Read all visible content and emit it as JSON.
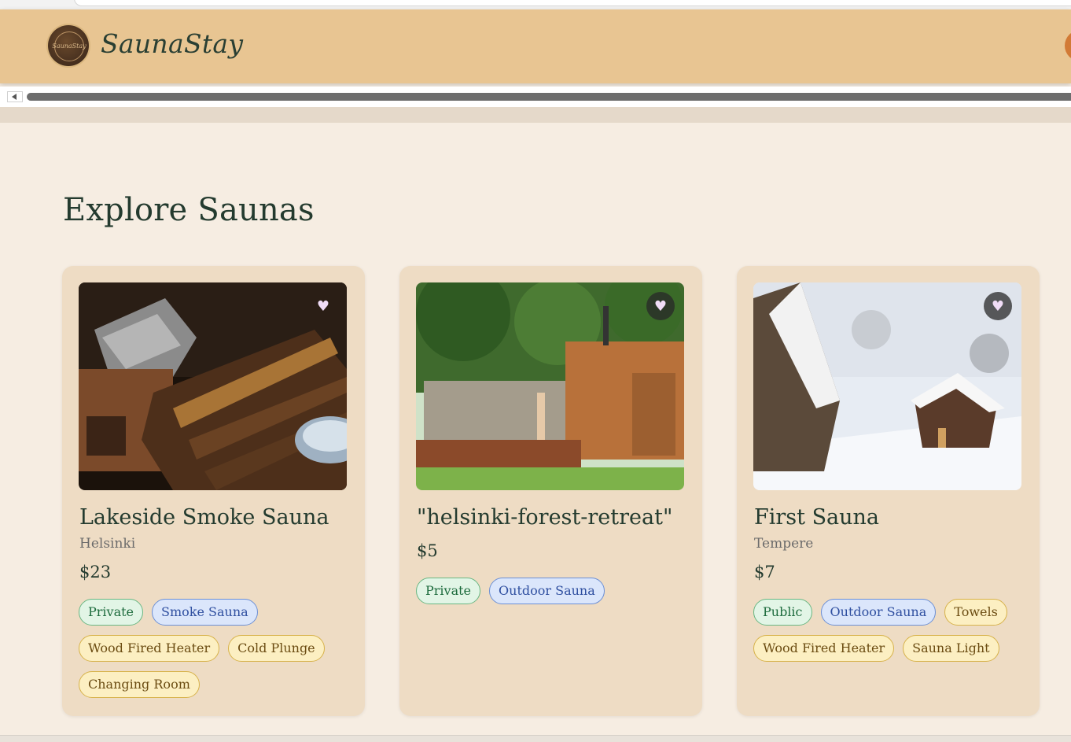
{
  "app": {
    "name": "SaunaStay",
    "logo_text": "SaunaStay"
  },
  "page": {
    "title": "Explore Saunas"
  },
  "colors": {
    "header_bg": "#e8c592",
    "page_bg": "#f6ede2",
    "card_bg": "#eedcc4",
    "tag_type": "#e2f5e6",
    "tag_sauna_type": "#dbe6fb",
    "tag_amenity": "#fcefc2"
  },
  "saunas": [
    {
      "title": "Lakeside Smoke Sauna",
      "location": "Helsinki",
      "price": "$23",
      "image": "sauna-interior-photo",
      "tags": [
        {
          "label": "Private",
          "kind": "green"
        },
        {
          "label": "Smoke Sauna",
          "kind": "blue"
        },
        {
          "label": "Wood Fired Heater",
          "kind": "yellow"
        },
        {
          "label": "Cold Plunge",
          "kind": "yellow"
        },
        {
          "label": "Changing Room",
          "kind": "yellow"
        }
      ]
    },
    {
      "title": "\"helsinki-forest-retreat\"",
      "location": "",
      "price": "$5",
      "image": "outdoor-sauna-photo",
      "tags": [
        {
          "label": "Private",
          "kind": "green"
        },
        {
          "label": "Outdoor Sauna",
          "kind": "blue"
        }
      ]
    },
    {
      "title": "First Sauna",
      "location": "Tempere",
      "price": "$7",
      "image": "snowy-cabin-photo",
      "tags": [
        {
          "label": "Public",
          "kind": "green"
        },
        {
          "label": "Outdoor Sauna",
          "kind": "blue"
        },
        {
          "label": "Towels",
          "kind": "yellow"
        },
        {
          "label": "Wood Fired Heater",
          "kind": "yellow"
        },
        {
          "label": "Sauna Light",
          "kind": "yellow"
        }
      ]
    }
  ],
  "icons": {
    "favorite": "heart-icon",
    "scroll_left": "scroll-left-arrow-icon"
  }
}
